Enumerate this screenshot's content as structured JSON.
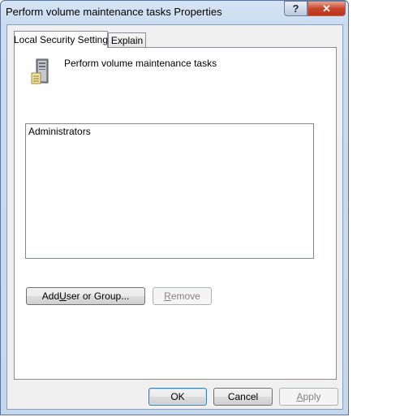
{
  "window": {
    "title": "Perform volume maintenance tasks Properties"
  },
  "caption_buttons": {
    "help": "?",
    "close": "✕"
  },
  "tabs": [
    {
      "label": "Local Security Setting",
      "selected": true
    },
    {
      "label": "Explain",
      "selected": false
    }
  ],
  "policy": {
    "name": "Perform volume maintenance tasks",
    "icon": "server-tower-icon"
  },
  "members": [
    "Administrators"
  ],
  "buttons": {
    "add_user_prefix": "Add ",
    "add_user_accel": "U",
    "add_user_suffix": "ser or Group...",
    "remove_accel": "R",
    "remove_suffix": "emove",
    "ok": "OK",
    "cancel": "Cancel",
    "apply_accel": "A",
    "apply_suffix": "pply"
  }
}
